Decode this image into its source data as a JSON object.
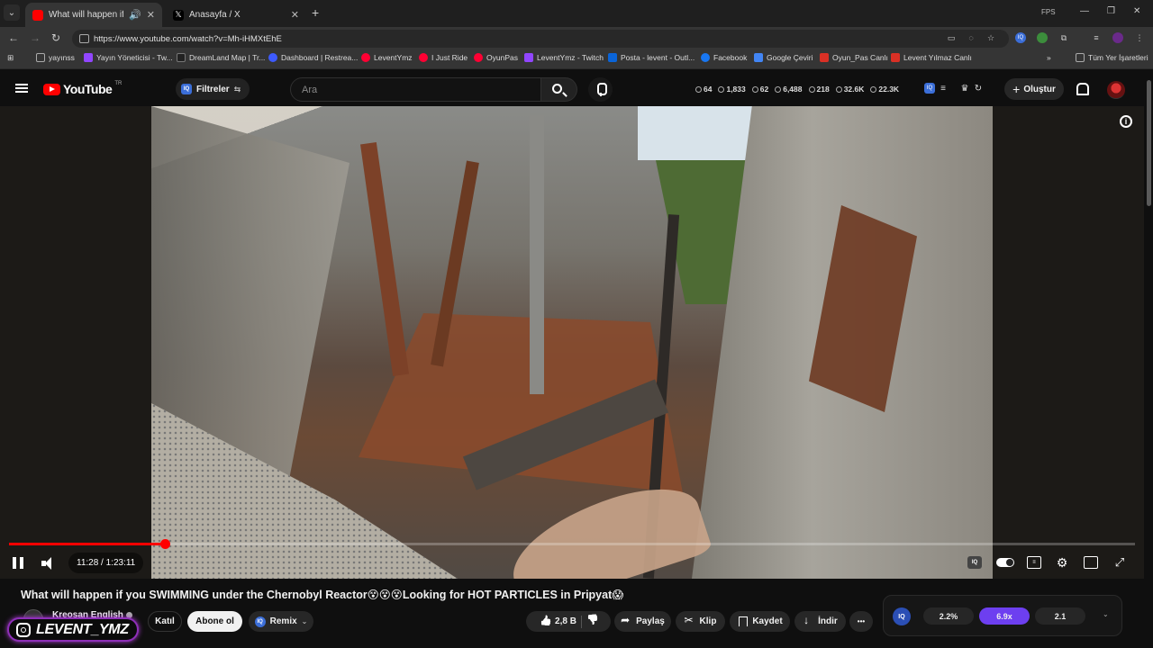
{
  "browser": {
    "tabs": [
      {
        "title": "What will happen if you SWIMMING under the Chernobyl Reactor",
        "active": true
      },
      {
        "title": "Anasayfa / X",
        "active": false
      }
    ],
    "new_tab_symbol": "+",
    "fps_label": "FPS",
    "window_controls": [
      "—",
      "❐",
      "✕"
    ],
    "url": "https://www.youtube.com/watch?v=Mh-iHMXtEhE",
    "bookmarks": [
      {
        "label": "yayınss",
        "color": "#9aa0a6"
      },
      {
        "label": "Yayın Yöneticisi - Tw...",
        "color": "#9146ff"
      },
      {
        "label": "DreamLand Map | Tr...",
        "color": "#222222"
      },
      {
        "label": "Dashboard | Restrea...",
        "color": "#3d5afe"
      },
      {
        "label": "LeventYmz",
        "color": "#ff0033"
      },
      {
        "label": "I Just Ride",
        "color": "#ff0033"
      },
      {
        "label": "OyunPas",
        "color": "#ff0033"
      },
      {
        "label": "LeventYmz - Twitch",
        "color": "#9146ff"
      },
      {
        "label": "Posta - levent - Outl...",
        "color": "#0a64d8"
      },
      {
        "label": "Facebook",
        "color": "#1877f2"
      },
      {
        "label": "Google Çeviri",
        "color": "#4285f4"
      },
      {
        "label": "Oyun_Pas Canlı",
        "color": "#d93025"
      },
      {
        "label": "Levent Yılmaz Canlı",
        "color": "#d93025"
      }
    ],
    "bookmarks_more": "»",
    "all_bookmarks": "Tüm Yer İşaretleri"
  },
  "youtube": {
    "logo_text": "YouTube",
    "country_code": "TR",
    "filters_label": "Filtreler",
    "search_placeholder": "Ara",
    "stats": [
      "64",
      "1,833",
      "62",
      "6,488",
      "218",
      "32.6K",
      "22.3K"
    ],
    "create_label": "Oluştur"
  },
  "player": {
    "current_time": "11:28",
    "duration": "1:23:11",
    "time_display": "11:28 / 1:23:11",
    "progress_fraction": 0.138,
    "info_symbol": "i"
  },
  "video": {
    "title": "What will happen if you SWIMMING under the Chernobyl Reactor😵😵😵Looking for HOT PARTICLES in Pripyat😱",
    "channel_name": "Kreosan English",
    "overlay_handle": "LEVENT_YMZ",
    "join_label": "Katıl",
    "subscribe_label": "Abone ol",
    "remix_label": "Remix",
    "like_count": "2,8 B",
    "share_label": "Paylaş",
    "clip_label": "Klip",
    "save_label": "Kaydet",
    "download_label": "İndir",
    "more_symbol": "•••"
  },
  "iq_panel": {
    "logo": "IQ",
    "values": [
      "2.2%",
      "6.9x",
      "2.1"
    ],
    "highlight_index": 1
  },
  "colors": {
    "accent_red": "#ff0000",
    "iq_purple": "#6d3ff0",
    "background": "#0f0f0f"
  }
}
